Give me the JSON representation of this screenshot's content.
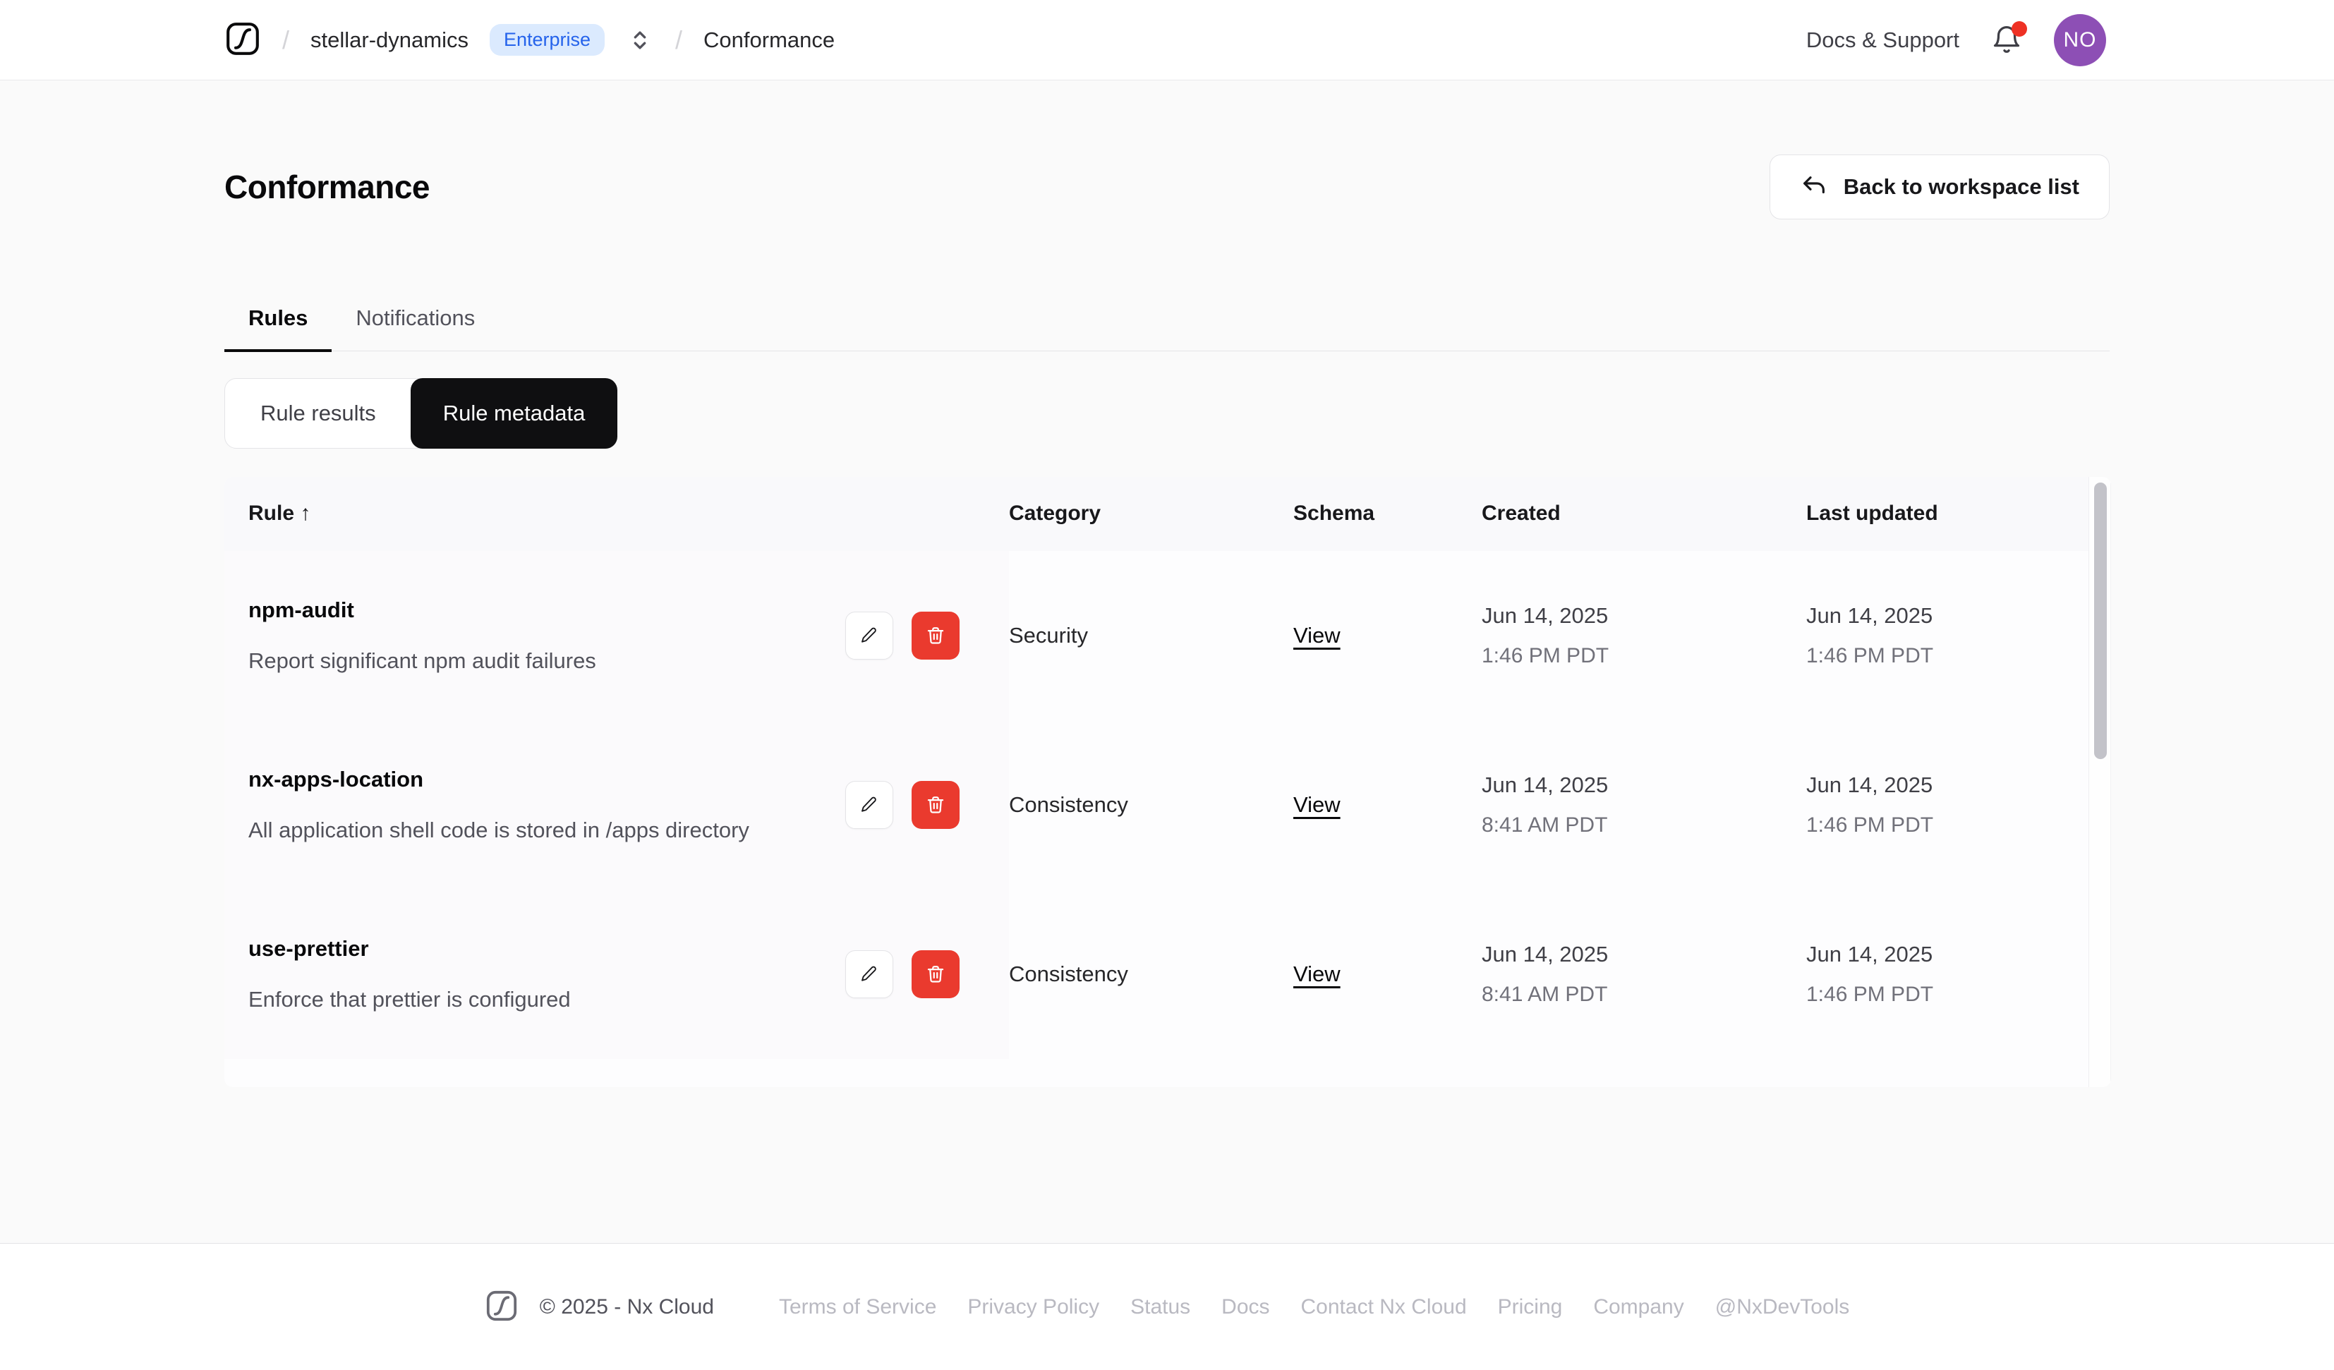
{
  "header": {
    "separator": "/",
    "workspace_name": "stellar-dynamics",
    "plan_badge": "Enterprise",
    "page_crumb": "Conformance",
    "docs_support": "Docs & Support",
    "avatar_initials": "NO"
  },
  "page": {
    "title": "Conformance",
    "back_button": "Back to workspace list"
  },
  "tabs": [
    {
      "label": "Rules",
      "active": true
    },
    {
      "label": "Notifications",
      "active": false
    }
  ],
  "view_toggle": [
    {
      "label": "Rule results",
      "active": false
    },
    {
      "label": "Rule metadata",
      "active": true
    }
  ],
  "table": {
    "columns": [
      "Rule",
      "Category",
      "Schema",
      "Created",
      "Last updated"
    ],
    "sort_arrow": "↑",
    "schema_link": "View",
    "rows": [
      {
        "name": "npm-audit",
        "description": "Report significant npm audit failures",
        "category": "Security",
        "created_date": "Jun 14, 2025",
        "created_time": "1:46 PM PDT",
        "updated_date": "Jun 14, 2025",
        "updated_time": "1:46 PM PDT"
      },
      {
        "name": "nx-apps-location",
        "description": "All application shell code is stored in /apps directory",
        "category": "Consistency",
        "created_date": "Jun 14, 2025",
        "created_time": "8:41 AM PDT",
        "updated_date": "Jun 14, 2025",
        "updated_time": "1:46 PM PDT"
      },
      {
        "name": "use-prettier",
        "description": "Enforce that prettier is configured",
        "category": "Consistency",
        "created_date": "Jun 14, 2025",
        "created_time": "8:41 AM PDT",
        "updated_date": "Jun 14, 2025",
        "updated_time": "1:46 PM PDT"
      }
    ]
  },
  "footer": {
    "copyright": "© 2025 - Nx Cloud",
    "links": [
      "Terms of Service",
      "Privacy Policy",
      "Status",
      "Docs",
      "Contact Nx Cloud",
      "Pricing",
      "Company",
      "@NxDevTools"
    ]
  },
  "colors": {
    "badge_blue_bg": "#dbeafe",
    "badge_blue_text": "#2563eb",
    "danger_red": "#ea3a2e",
    "notification_red": "#ee3124",
    "avatar_purple": "#8d4fb5",
    "active_black": "#0f0f11",
    "page_bg": "#fafafa"
  }
}
